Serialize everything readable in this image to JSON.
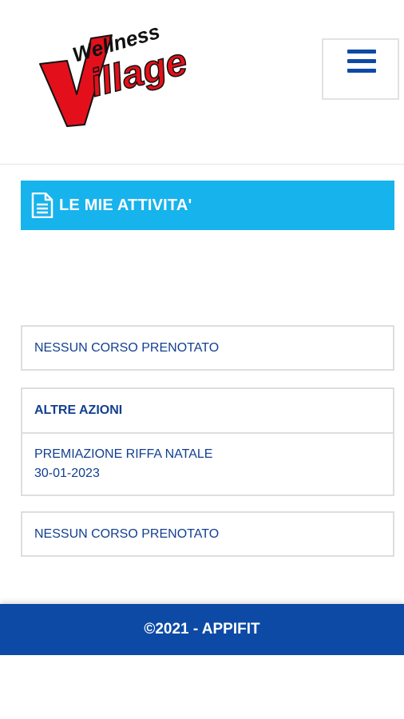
{
  "header": {
    "logo_text_top": "Wellness",
    "logo_text_main": "Village",
    "logo_colors": {
      "red": "#e3101b",
      "black": "#111111"
    },
    "menu_icon": "hamburger-icon"
  },
  "section": {
    "title": "LE MIE ATTIVITA'",
    "icon": "document-icon",
    "color": "#17b3ec"
  },
  "cards": {
    "first": {
      "text": "NESSUN CORSO PRENOTATO"
    },
    "actions": {
      "header": "ALTRE AZIONI",
      "item_line1": "PREMIAZIONE RIFFA NATALE",
      "item_line2": "30-01-2023"
    },
    "last": {
      "text": "NESSUN CORSO PRENOTATO"
    },
    "text_color": "#123f91"
  },
  "footer": {
    "text": "©2021 - APPIFIT",
    "color": "#0c4aa6"
  }
}
